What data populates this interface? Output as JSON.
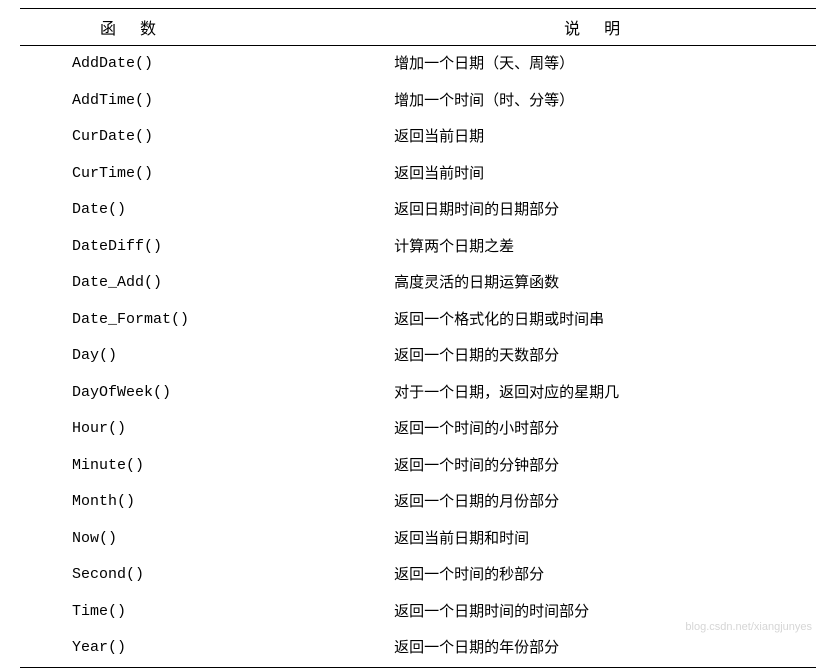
{
  "headers": {
    "func": "函数",
    "desc": "说明"
  },
  "rows": [
    {
      "func": "AddDate()",
      "desc": "增加一个日期（天、周等）"
    },
    {
      "func": "AddTime()",
      "desc": "增加一个时间（时、分等）"
    },
    {
      "func": "CurDate()",
      "desc": "返回当前日期"
    },
    {
      "func": "CurTime()",
      "desc": "返回当前时间"
    },
    {
      "func": "Date()",
      "desc": "返回日期时间的日期部分"
    },
    {
      "func": "DateDiff()",
      "desc": "计算两个日期之差"
    },
    {
      "func": "Date_Add()",
      "desc": "高度灵活的日期运算函数"
    },
    {
      "func": "Date_Format()",
      "desc": "返回一个格式化的日期或时间串"
    },
    {
      "func": "Day()",
      "desc": "返回一个日期的天数部分"
    },
    {
      "func": "DayOfWeek()",
      "desc": "对于一个日期，返回对应的星期几"
    },
    {
      "func": "Hour()",
      "desc": "返回一个时间的小时部分"
    },
    {
      "func": "Minute()",
      "desc": "返回一个时间的分钟部分"
    },
    {
      "func": "Month()",
      "desc": "返回一个日期的月份部分"
    },
    {
      "func": "Now()",
      "desc": "返回当前日期和时间"
    },
    {
      "func": "Second()",
      "desc": "返回一个时间的秒部分"
    },
    {
      "func": "Time()",
      "desc": "返回一个日期时间的时间部分"
    },
    {
      "func": "Year()",
      "desc": "返回一个日期的年份部分"
    }
  ],
  "watermark": "blog.csdn.net/xiangjunyes"
}
